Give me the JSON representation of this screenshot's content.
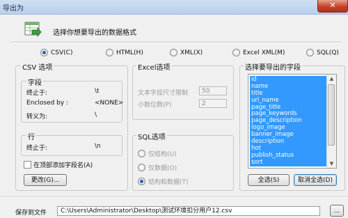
{
  "window": {
    "title": "导出为",
    "close_label": "✕"
  },
  "header": {
    "prompt": "选择你想要导出的数据格式"
  },
  "formats": [
    {
      "label": "CSV(C)",
      "selected": true
    },
    {
      "label": "HTML(H)",
      "selected": false
    },
    {
      "label": "XML(X)",
      "selected": false
    },
    {
      "label": "Excel XML(M)",
      "selected": false
    },
    {
      "label": "SQL(Q)",
      "selected": false
    }
  ],
  "csv_options": {
    "title": "CSV 选项",
    "field_section": "字段",
    "terminated_label": "终止于:",
    "terminated_value": "\\t",
    "enclosed_label": "Enclosed by :",
    "enclosed_value": "<NONE>",
    "escape_label": "转义为:",
    "escape_value": "\\",
    "row_section": "行",
    "row_terminated_label": "终止于:",
    "row_terminated_value": "\\n",
    "add_header_checkbox": "在顶部添加字段名(A)",
    "change_button": "更改(G)..."
  },
  "excel_options": {
    "title": "Excel选项",
    "text_size_label": "文本字段尺寸限制",
    "text_size_value": "50",
    "decimals_label": "小数位数(P)",
    "decimals_value": "2"
  },
  "sql_options": {
    "title": "SQL选项",
    "structure_only": "仅结构(U)",
    "data_only": "仅数据(O)",
    "structure_and_data": "结构和数据(T)"
  },
  "fields_panel": {
    "title": "选择要导出的字段",
    "items": [
      "id",
      "name",
      "title",
      "url_name",
      "page_title",
      "page_keywords",
      "page_description",
      "logo_image",
      "banner_image",
      "description",
      "hot",
      "publish_status",
      "sort"
    ],
    "select_all_button": "全选(S)",
    "deselect_all_button": "取消全选(D)"
  },
  "save": {
    "label": "保存到文件",
    "path": "C:\\Users\\Administrator\\Desktop\\测试环境扣分用户12.csv",
    "browse_button": "..."
  }
}
